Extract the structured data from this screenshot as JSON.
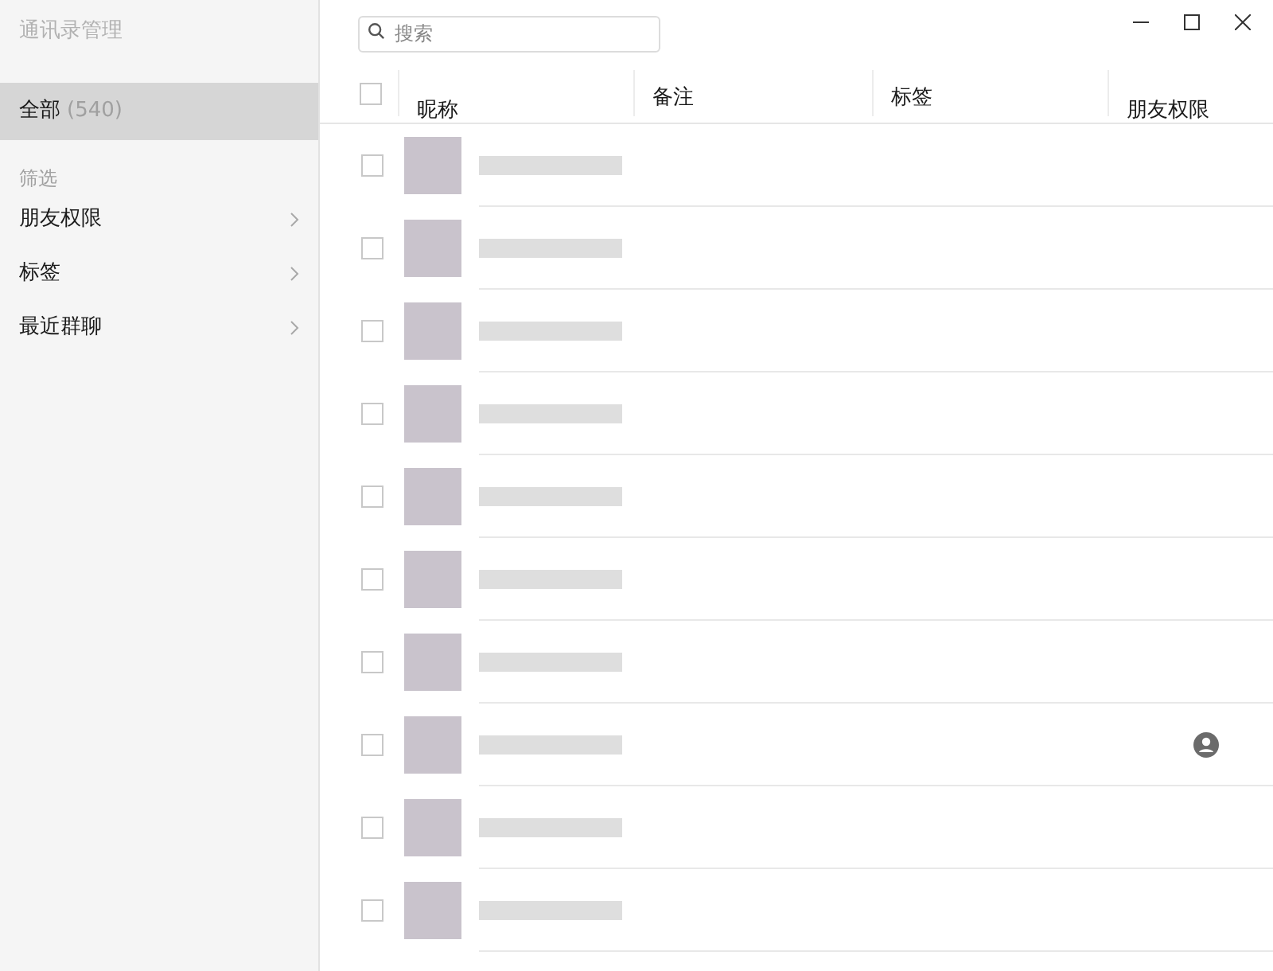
{
  "sidebar": {
    "title": "通讯录管理",
    "items": [
      {
        "label": "全部",
        "count": "(540)",
        "selected": true
      }
    ],
    "filter_heading": "筛选",
    "filters": [
      {
        "label": "朋友权限"
      },
      {
        "label": "标签"
      },
      {
        "label": "最近群聊"
      }
    ]
  },
  "search": {
    "placeholder": "搜索"
  },
  "table": {
    "select_all_checked": false,
    "columns": [
      "昵称",
      "备注",
      "标签",
      "朋友权限"
    ],
    "rows": [
      {
        "checked": false,
        "limited_permission": false
      },
      {
        "checked": false,
        "limited_permission": false
      },
      {
        "checked": false,
        "limited_permission": false
      },
      {
        "checked": false,
        "limited_permission": false
      },
      {
        "checked": false,
        "limited_permission": false
      },
      {
        "checked": false,
        "limited_permission": false
      },
      {
        "checked": false,
        "limited_permission": false
      },
      {
        "checked": false,
        "limited_permission": true
      },
      {
        "checked": false,
        "limited_permission": false
      },
      {
        "checked": false,
        "limited_permission": false
      }
    ]
  }
}
